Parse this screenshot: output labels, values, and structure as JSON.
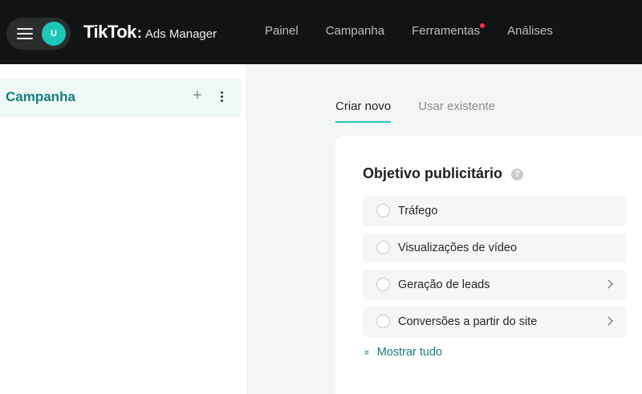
{
  "header": {
    "avatar_initial": "U",
    "brand_name": "TikTok",
    "brand_separator": ":",
    "brand_product": "Ads Manager",
    "nav": [
      {
        "label": "Painel"
      },
      {
        "label": "Campanha"
      },
      {
        "label": "Ferramentas",
        "notification": true
      },
      {
        "label": "Análises"
      }
    ]
  },
  "sidebar": {
    "title": "Campanha",
    "add_symbol": "+"
  },
  "tabs": [
    {
      "label": "Criar novo",
      "active": true
    },
    {
      "label": "Usar existente",
      "active": false
    }
  ],
  "objective": {
    "title": "Objetivo publicitário",
    "help_symbol": "?",
    "options": [
      {
        "label": "Tráfego",
        "selected": false,
        "expandable": false
      },
      {
        "label": "Visualizações de vídeo",
        "selected": false,
        "expandable": false
      },
      {
        "label": "Geração de leads",
        "selected": false,
        "expandable": true
      },
      {
        "label": "Conversões a partir do site",
        "selected": false,
        "expandable": true
      }
    ],
    "show_all_icon": "»",
    "show_all_label": "Mostrar tudo"
  },
  "colors": {
    "accent": "#1ec6b8",
    "accent_text": "#167f7b",
    "topbar": "#111315",
    "notification": "#fe2c55"
  },
  "icons": [
    "hamburger-menu-icon",
    "help-icon",
    "chevron-right-icon",
    "double-chevron-down-icon",
    "more-vertical-icon"
  ]
}
